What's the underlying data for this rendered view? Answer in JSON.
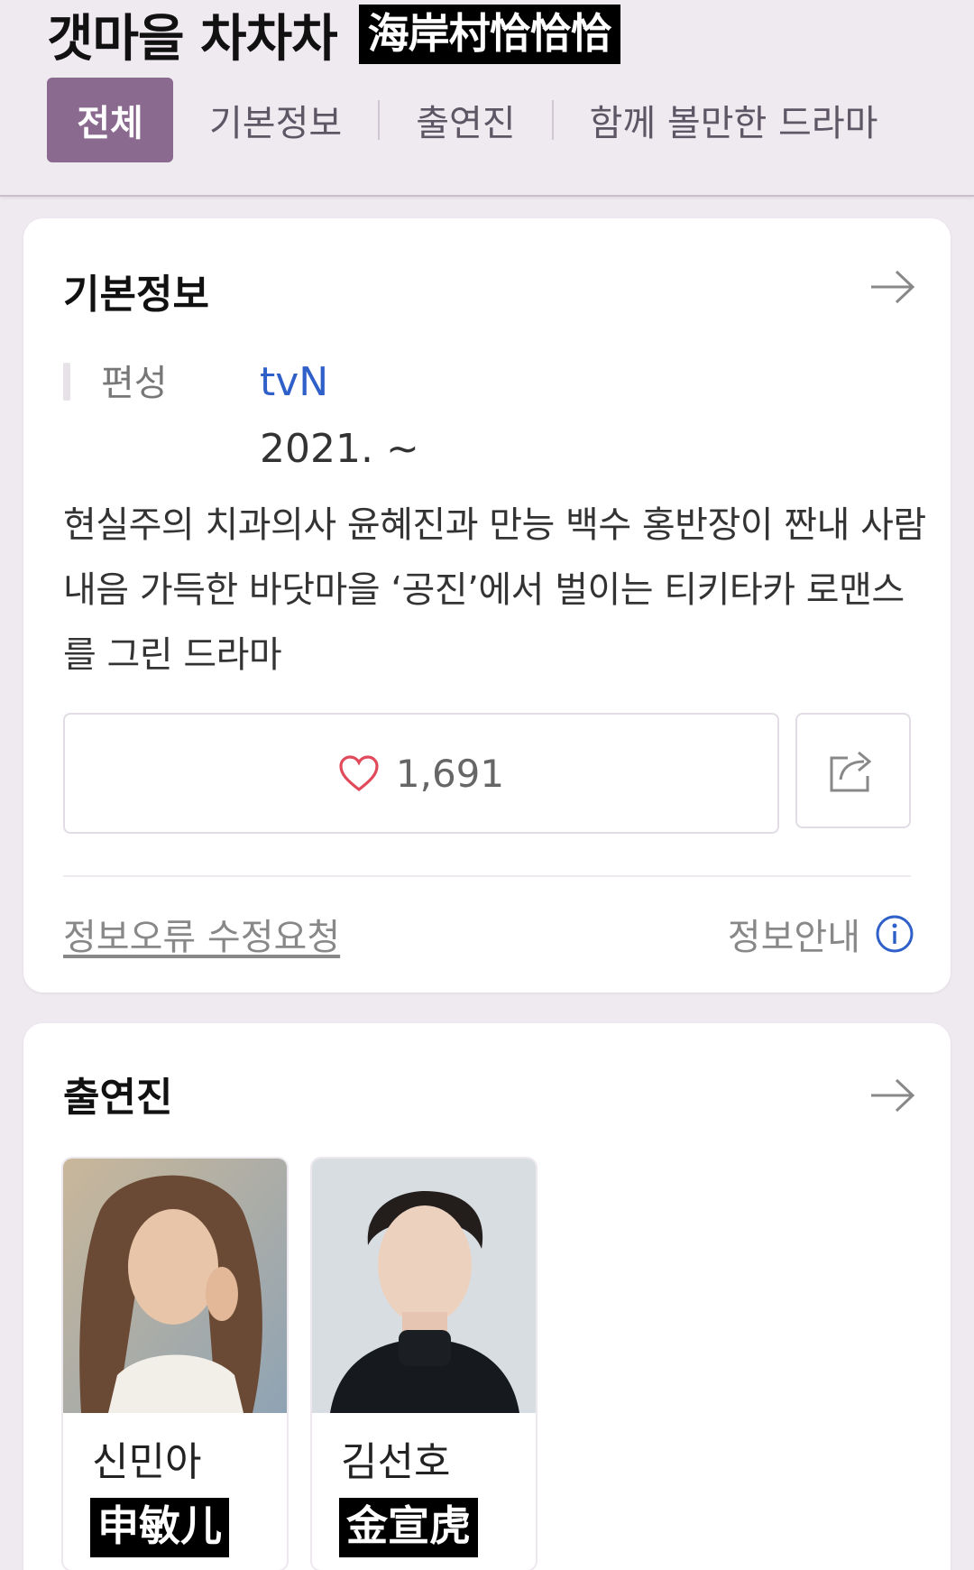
{
  "header": {
    "title": "갯마을 차차차",
    "title_overlay": "海岸村恰恰恰",
    "tabs": [
      {
        "label": "전체",
        "active": true
      },
      {
        "label": "기본정보",
        "active": false
      },
      {
        "label": "출연진",
        "active": false
      },
      {
        "label": "함께 볼만한 드라마",
        "active": false
      }
    ]
  },
  "basic_info": {
    "title": "기본정보",
    "arrow_icon": "arrow-right-icon",
    "network_label": "편성",
    "network": "tvN",
    "date": "2021. ~",
    "summary": "현실주의 치과의사 윤혜진과 만능 백수 홍반장이 짠내 사람내음 가득한 바닷마을 ‘공진’에서 벌이는 티키타카 로맨스를 그린 드라마",
    "like_count": "1,691",
    "like_icon": "heart-outline-icon",
    "share_icon": "share-icon",
    "error_report": "정보오류 수정요청",
    "info_guide": "정보안내",
    "info_icon": "info-icon",
    "colors": {
      "accent": "#8a6a8f",
      "link": "#2f5fc8",
      "heart": "#e04a5a"
    }
  },
  "cast": {
    "title": "출연진",
    "arrow_icon": "arrow-right-icon",
    "members": [
      {
        "name": "신민아",
        "hanja": "申敏儿"
      },
      {
        "name": "김선호",
        "hanja": "金宣虎"
      }
    ]
  }
}
